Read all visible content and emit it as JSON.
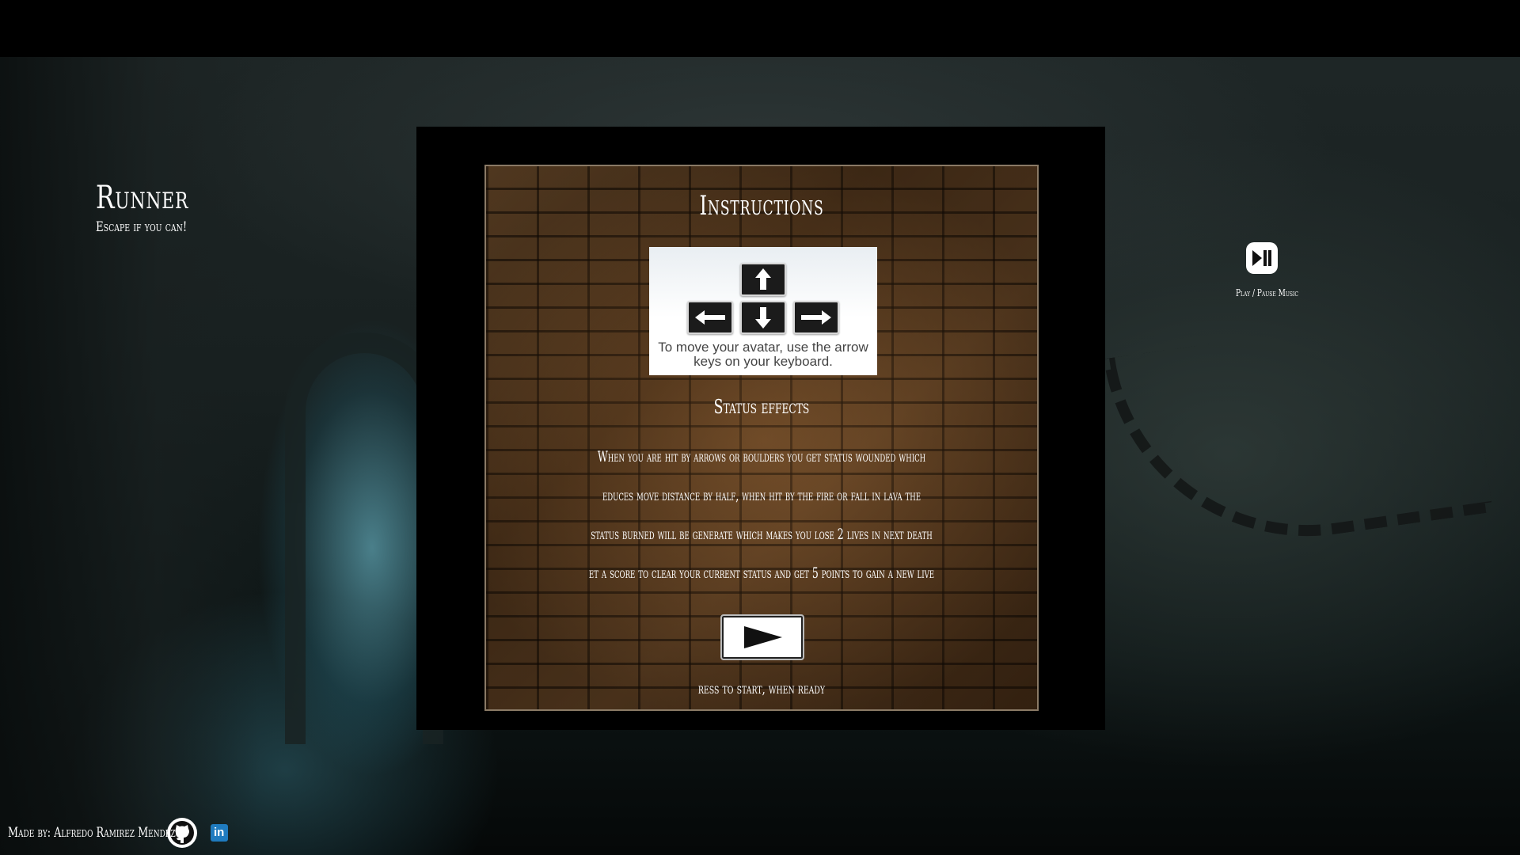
{
  "header": {
    "title": "Runner",
    "tagline": "Escape if you can!"
  },
  "music": {
    "label": "Play / Pause Music",
    "icon": "play-pause-icon"
  },
  "instructions": {
    "title": "Instructions",
    "keys_caption": "To move your avatar, use the arrow keys on your keyboard.",
    "keys": [
      "arrow-up-key",
      "arrow-left-key",
      "arrow-down-key",
      "arrow-right-key"
    ],
    "status_heading": "Status effects",
    "status_lines": [
      "When you are hit by arrows or boulders you get status wounded which",
      "educes move distance by half, when hit by the fire or fall in lava the",
      "status burned will be generate which makes you lose 2 lives in next death",
      "et a score to clear your current status and get 5 points to gain a new live"
    ],
    "start_icon": "play-icon",
    "start_hint": "ress to start, when ready"
  },
  "footer": {
    "credit": "Made by: Alfredo Ramirez Mendez",
    "github_icon": "github-icon",
    "linkedin_text": "in"
  },
  "colors": {
    "background": "#000000",
    "brick": "#5a3a1e",
    "linkedin": "#1f7bbf",
    "text": "#ffffff"
  }
}
